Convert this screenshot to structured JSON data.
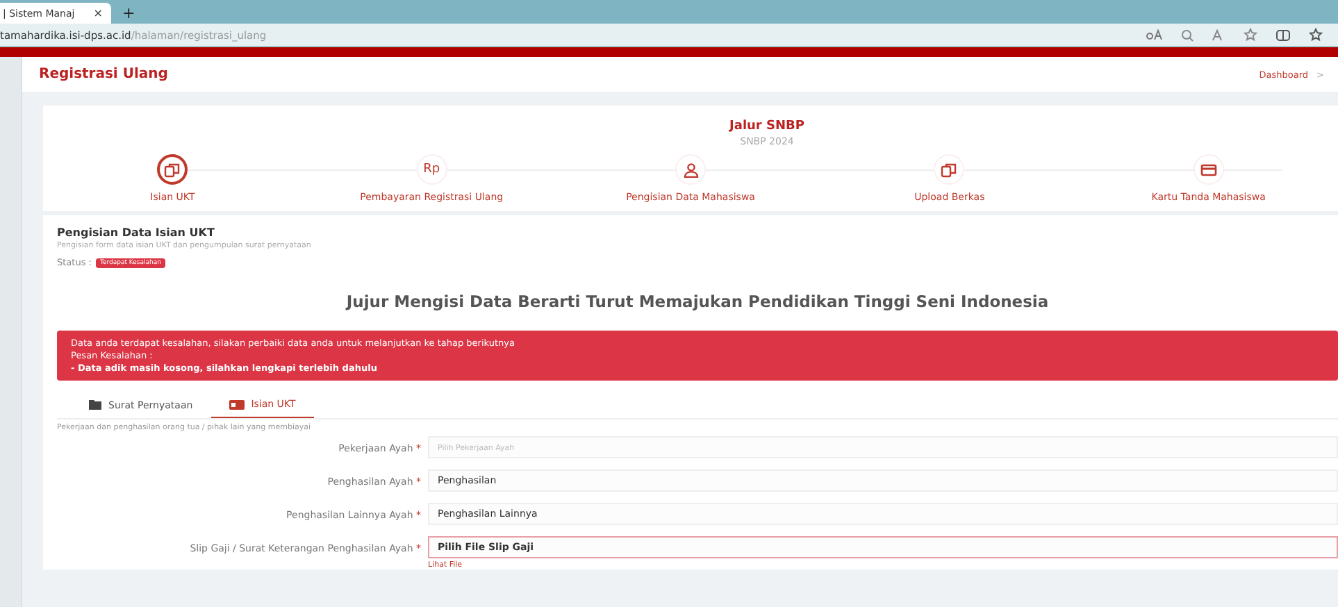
{
  "browser": {
    "tab_title": "| Sistem Manaj",
    "tab_close": "×",
    "new_tab": "+",
    "url_host": "tamahardika.isi-dps.ac.id",
    "url_path": "/halaman/registrasi_ulang"
  },
  "header": {
    "title": "Registrasi Ulang",
    "breadcrumb": "Dashboard",
    "breadcrumb_separator": ">"
  },
  "stepper": {
    "title": "Jalur SNBP",
    "subtitle": "SNBP 2024",
    "steps": [
      {
        "label": "Isian UKT",
        "kind": "docs",
        "selected": true
      },
      {
        "label": "Pembayaran Registrasi Ulang",
        "kind": "text",
        "icon_text": "Rp",
        "selected": false
      },
      {
        "label": "Pengisian Data Mahasiswa",
        "kind": "person",
        "selected": false
      },
      {
        "label": "Upload Berkas",
        "kind": "docs",
        "selected": false
      },
      {
        "label": "Kartu Tanda Mahasiswa",
        "kind": "card",
        "selected": false
      }
    ]
  },
  "section": {
    "title": "Pengisian Data Isian UKT",
    "subtitle": "Pengisian form data isian UKT dan pengumpulan surat pernyataan",
    "status_label": "Status :",
    "status_badge": "Terdapat Kesalahan"
  },
  "headline": "Jujur Mengisi Data Berarti Turut Memajukan Pendidikan Tinggi Seni Indonesia",
  "alert": {
    "message": "Data anda terdapat kesalahan, silakan perbaiki data anda untuk melanjutkan ke tahap berikutnya",
    "error_heading": "Pesan Kesalahan :",
    "error_item": "- Data adik masih kosong, silahkan lengkapi terlebih dahulu"
  },
  "tabs": [
    {
      "label": "Surat Pernyataan",
      "kind": "folder",
      "selected": false
    },
    {
      "label": "Isian UKT",
      "kind": "card",
      "selected": true
    }
  ],
  "form": {
    "note": "Pekerjaan dan penghasilan orang tua / pihak lain yang membiayai",
    "fields": [
      {
        "label": "Pekerjaan Ayah",
        "mark": "*",
        "kind": "select",
        "placeholder": "Pilih Pekerjaan Ayah",
        "error": false
      },
      {
        "label": "Penghasilan Ayah",
        "mark": "*",
        "kind": "input",
        "value": "Penghasilan",
        "error": false
      },
      {
        "label": "Penghasilan Lainnya Ayah",
        "mark": "*",
        "kind": "input",
        "value": "Penghasilan Lainnya",
        "error": false
      },
      {
        "label": "Slip Gaji / Surat Keterangan Penghasilan Ayah",
        "mark": "*",
        "kind": "file",
        "value": "Pilih File Slip Gaji",
        "error": true,
        "link": "Lihat File"
      }
    ]
  }
}
